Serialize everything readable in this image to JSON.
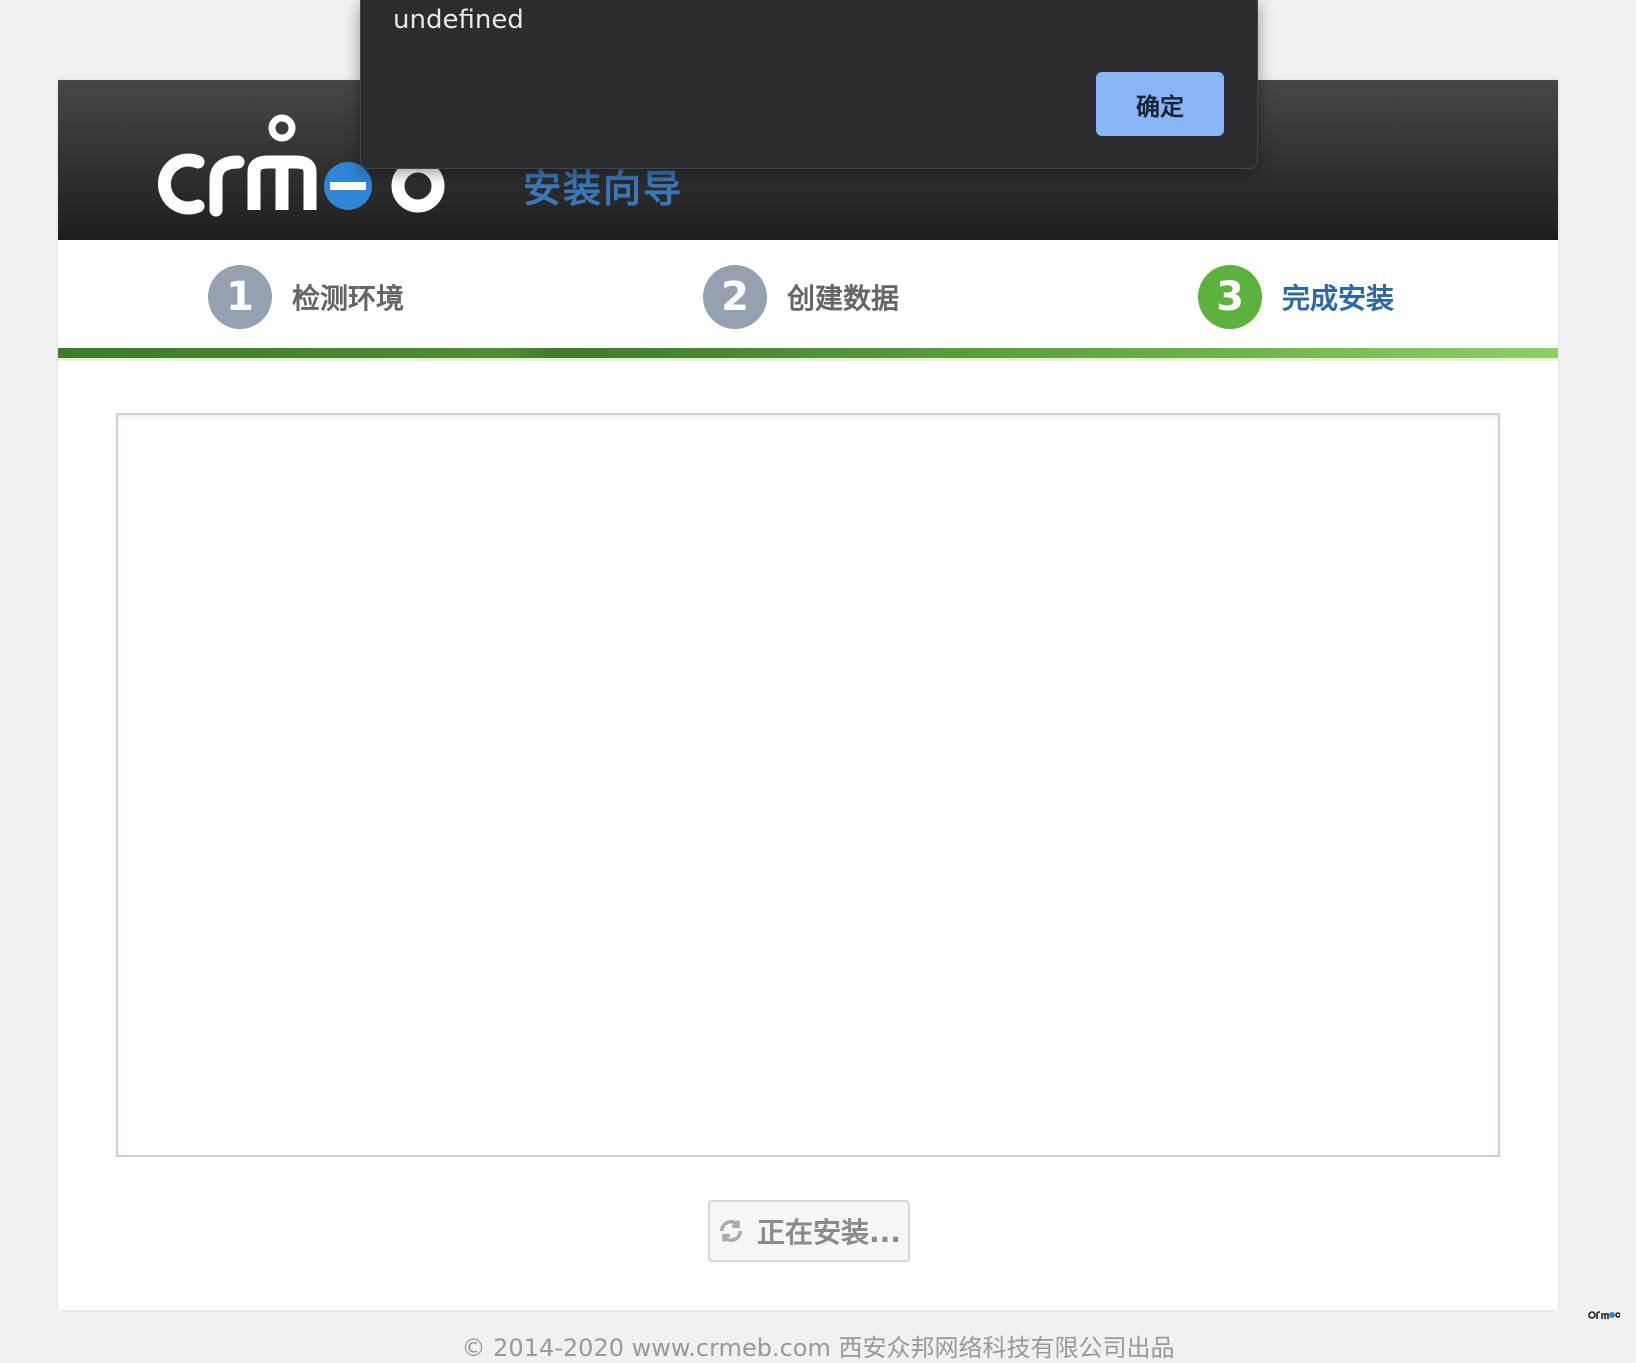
{
  "header": {
    "logo_text": "crmeb",
    "title": "安装向导"
  },
  "steps": [
    {
      "num": "1",
      "label": "检测环境",
      "active": false
    },
    {
      "num": "2",
      "label": "创建数据",
      "active": false
    },
    {
      "num": "3",
      "label": "完成安装",
      "active": true
    }
  ],
  "install_button": {
    "label": "正在安装...",
    "icon": "refresh-icon"
  },
  "footer": {
    "text": "© 2014-2020 www.crmeb.com 西安众邦网络科技有限公司出品"
  },
  "dialog": {
    "message": "undefined",
    "ok_label": "确定"
  },
  "colors": {
    "accent_blue": "#3c78b8",
    "step_active": "#5cb23d",
    "step_inactive": "#95a0b0",
    "dialog_button": "#8ab4f8"
  }
}
